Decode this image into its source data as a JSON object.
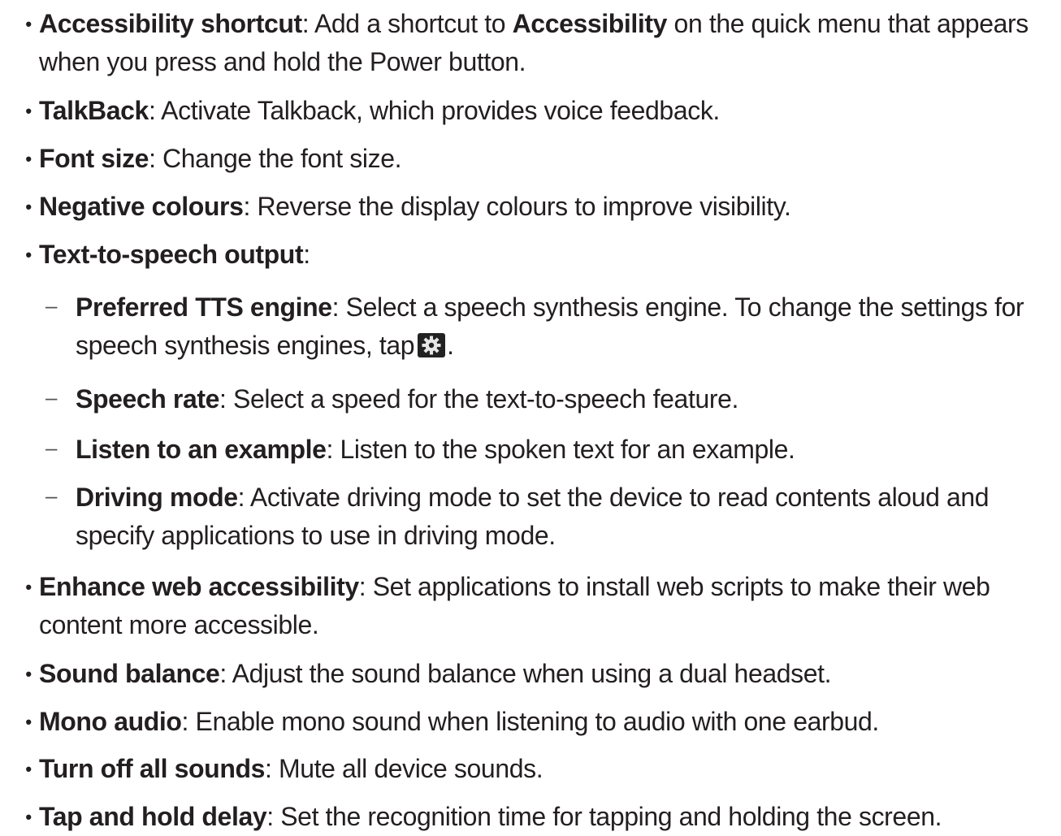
{
  "items": [
    {
      "bold": "Accessibility shortcut",
      "pre": ": Add a shortcut to ",
      "bold2": "Accessibility",
      "post": " on the quick menu that appears when you press and hold the Power button."
    },
    {
      "bold": "TalkBack",
      "text": ": Activate Talkback, which provides voice feedback."
    },
    {
      "bold": "Font size",
      "text": ": Change the font size."
    },
    {
      "bold": "Negative colours",
      "text": ": Reverse the display colours to improve visibility."
    },
    {
      "bold": "Text-to-speech output",
      "text": ":"
    },
    {
      "bold": "Preferred TTS engine",
      "text": ": Select a speech synthesis engine. To change the settings for speech synthesis engines, tap",
      "after_icon": ".",
      "icon": "settings-gear-icon"
    },
    {
      "bold": "Speech rate",
      "text": ": Select a speed for the text-to-speech feature."
    },
    {
      "bold": "Listen to an example",
      "text": ": Listen to the spoken text for an example."
    },
    {
      "bold": "Driving mode",
      "text": ": Activate driving mode to set the device to read contents aloud and specify applications to use in driving mode."
    },
    {
      "bold": "Enhance web accessibility",
      "text": ": Set applications to install web scripts to make their web content more accessible."
    },
    {
      "bold": "Sound balance",
      "text": ": Adjust the sound balance when using a dual headset."
    },
    {
      "bold": "Mono audio",
      "text": ": Enable mono sound when listening to audio with one earbud."
    },
    {
      "bold": "Turn off all sounds",
      "text": ": Mute all device sounds."
    },
    {
      "bold": "Tap and hold delay",
      "text": ": Set the recognition time for tapping and holding the screen."
    }
  ],
  "bullet": "•",
  "dash": "–"
}
